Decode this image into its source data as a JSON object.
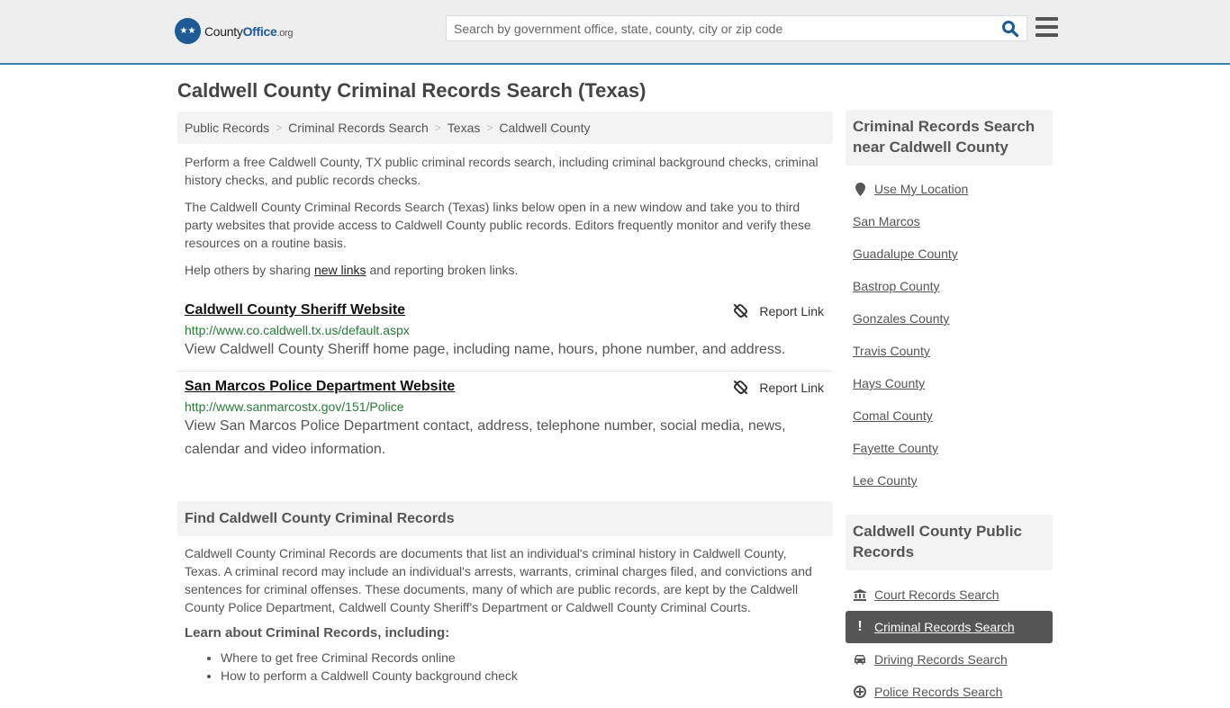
{
  "header": {
    "logo": {
      "name_part1": "County",
      "name_part2": "Office",
      "name_part3": ".org"
    },
    "search": {
      "placeholder": "Search by government office, state, county, city or zip code",
      "value": ""
    }
  },
  "page_title": "Caldwell County Criminal Records Search (Texas)",
  "breadcrumb": [
    "Public Records",
    "Criminal Records Search",
    "Texas",
    "Caldwell County"
  ],
  "intro": {
    "p1": "Perform a free Caldwell County, TX public criminal records search, including criminal background checks, criminal history checks, and public records checks.",
    "p2": "The Caldwell County Criminal Records Search (Texas) links below open in a new window and take you to third party websites that provide access to Caldwell County public records. Editors frequently monitor and verify these resources on a routine basis.",
    "p3_before": "Help others by sharing ",
    "p3_link": "new links",
    "p3_after": " and reporting broken links."
  },
  "links": [
    {
      "title": "Caldwell County Sheriff Website",
      "url": "http://www.co.caldwell.tx.us/default.aspx",
      "description": "View Caldwell County Sheriff home page, including name, hours, phone number, and address.",
      "report_label": "Report Link"
    },
    {
      "title": "San Marcos Police Department Website",
      "url": "http://www.sanmarcostx.gov/151/Police",
      "description": "View San Marcos Police Department contact, address, telephone number, social media, news, calendar and video information.",
      "report_label": "Report Link"
    }
  ],
  "find_section": {
    "heading": "Find Caldwell County Criminal Records",
    "paragraph": "Caldwell County Criminal Records are documents that list an individual's criminal history in Caldwell County, Texas. A criminal record may include an individual's arrests, warrants, criminal charges filed, and convictions and sentences for criminal offenses. These documents, many of which are public records, are kept by the Caldwell County Police Department, Caldwell County Sheriff's Department or Caldwell County Criminal Courts.",
    "learn_heading": "Learn about Criminal Records, including:",
    "learn_items": [
      "Where to get free Criminal Records online",
      "How to perform a Caldwell County background check"
    ]
  },
  "sidebar": {
    "nearby": {
      "heading": "Criminal Records Search near Caldwell County",
      "use_location": "Use My Location",
      "items": [
        "San Marcos",
        "Guadalupe County",
        "Bastrop County",
        "Gonzales County",
        "Travis County",
        "Hays County",
        "Comal County",
        "Fayette County",
        "Lee County"
      ]
    },
    "public_records": {
      "heading": "Caldwell County Public Records",
      "items": [
        {
          "label": "Court Records Search",
          "icon": "courthouse-icon",
          "active": false
        },
        {
          "label": "Criminal Records Search",
          "icon": "exclamation-icon",
          "active": true
        },
        {
          "label": "Driving Records Search",
          "icon": "car-icon",
          "active": false
        },
        {
          "label": "Police Records Search",
          "icon": "police-badge-icon",
          "active": false
        }
      ]
    }
  }
}
